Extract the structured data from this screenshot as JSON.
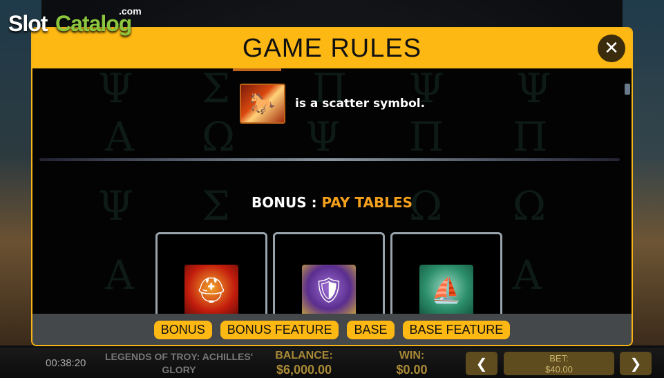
{
  "logo": {
    "slot": "Slot",
    "catalog": "Catalog",
    "com": ".com"
  },
  "modal": {
    "title": "GAME RULES",
    "close_icon": "✕",
    "scatter_text": "is a scatter symbol.",
    "section_heading_key": "BONUS : ",
    "section_heading_value": "PAY TABLES",
    "cards": [
      {
        "name": "helmet",
        "glyph": "⛑"
      },
      {
        "name": "shield",
        "glyph": "🛡"
      },
      {
        "name": "ship",
        "glyph": "⛵"
      }
    ],
    "tabs": [
      "BONUS",
      "BONUS FEATURE",
      "BASE",
      "BASE FEATURE"
    ]
  },
  "game_bar": {
    "clock": "00:38:20",
    "title": "LEGENDS OF TROY: ACHILLES' GLORY",
    "balance_label": "BALANCE:",
    "balance_value": "$6,000.00",
    "win_label": "WIN:",
    "win_value": "$0.00",
    "bet_label": "BET:",
    "bet_value": "$40.00",
    "prev_icon": "❮",
    "next_icon": "❯"
  },
  "colors": {
    "accent": "#fdb813",
    "heading_value": "#f4a01c",
    "tab_bar": "#45484b",
    "logo_green": "#8cc63f"
  }
}
